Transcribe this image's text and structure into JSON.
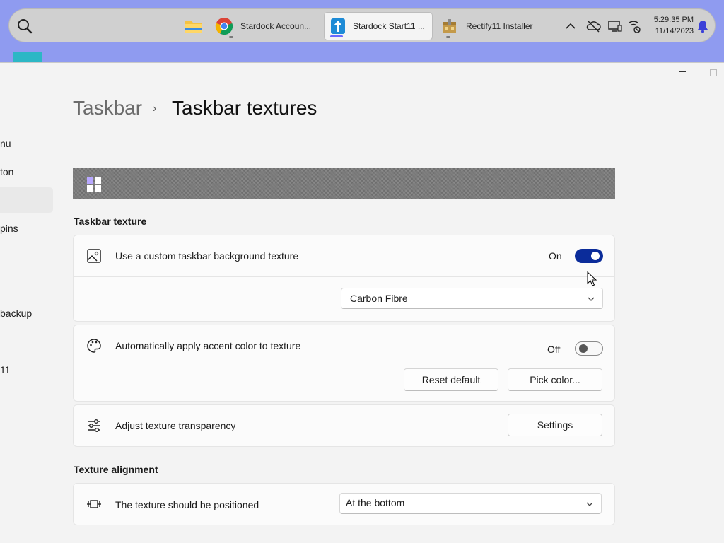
{
  "taskbar": {
    "apps": [
      {
        "label": ""
      },
      {
        "label": "Stardock Accoun..."
      },
      {
        "label": "Stardock Start11 ..."
      },
      {
        "label": "Rectify11 Installer"
      }
    ],
    "clock": {
      "time": "5:29:35 PM",
      "date": "11/14/2023"
    }
  },
  "sidebar": {
    "items": [
      "nu",
      "ton",
      "",
      "pins",
      "backup",
      "11"
    ]
  },
  "breadcrumb": {
    "parent": "Taskbar",
    "separator": "›",
    "current": "Taskbar textures"
  },
  "sections": {
    "texture": "Taskbar texture",
    "alignment": "Texture alignment"
  },
  "rows": {
    "custom_texture": {
      "label": "Use a custom taskbar background texture",
      "state": "On",
      "selected": "Carbon Fibre"
    },
    "accent": {
      "label": "Automatically apply accent color to texture",
      "state": "Off",
      "reset_label": "Reset default",
      "pick_label": "Pick color..."
    },
    "transparency": {
      "label": "Adjust texture transparency",
      "button_label": "Settings"
    },
    "position": {
      "label": "The texture should be positioned",
      "selected": "At the bottom"
    }
  },
  "colors": {
    "accent": "#0b2c9a",
    "desktop": "#8f9bf0",
    "taskbar": "#d0d0d0"
  },
  "icons": [
    "search-icon",
    "file-explorer-icon",
    "chrome-icon",
    "start11-icon",
    "installer-icon",
    "chevron-up-icon",
    "cloud-icon",
    "display-icon",
    "network-icon",
    "bell-icon",
    "image-icon",
    "palette-icon",
    "sliders-icon",
    "align-icon",
    "chevron-down-icon"
  ]
}
